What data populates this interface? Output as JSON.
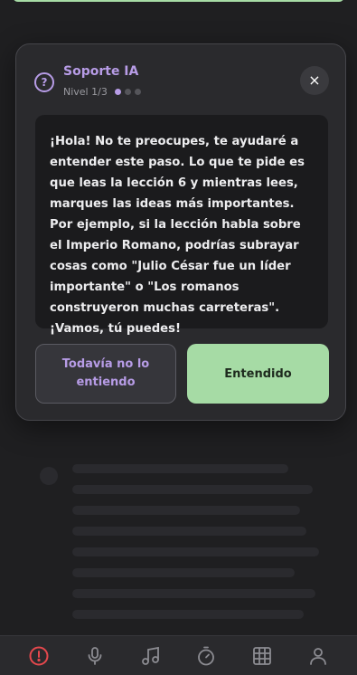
{
  "modal": {
    "title": "Soporte IA",
    "level": "Nivel 1/3",
    "close_label": "×",
    "help_icon_glyph": "?",
    "message": "¡Hola! No te preocupes, te ayudaré a entender este paso. Lo que te pide es que leas la lección 6 y mientras lees, marques las ideas más importantes. Por ejemplo, si la lección habla sobre el Imperio Romano, podrías subrayar cosas como \"Julio César fue un líder importante\" o \"Los romanos construyeron muchas carreteras\". ¡Vamos, tú puedes!",
    "secondary_button": "Todavía no lo entiendo",
    "primary_button": "Entendido",
    "level_dots": 3,
    "active_dot": 1
  },
  "colors": {
    "accent": "#b79ce6",
    "primary": "#a6dba5",
    "alert": "#e5484d"
  },
  "bottom_nav": [
    {
      "name": "alert-icon"
    },
    {
      "name": "microphone-icon"
    },
    {
      "name": "music-note-icon"
    },
    {
      "name": "timer-icon"
    },
    {
      "name": "grid-icon"
    },
    {
      "name": "user-icon"
    }
  ]
}
